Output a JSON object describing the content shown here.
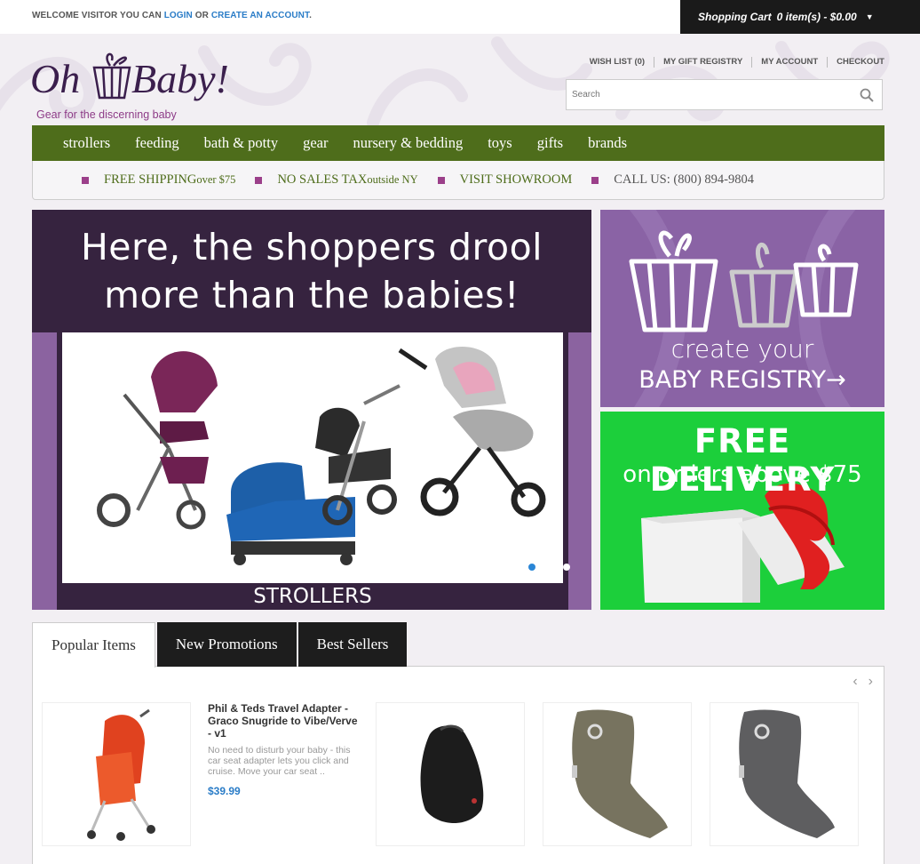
{
  "topbar": {
    "welcome_text": "WELCOME VISITOR YOU CAN ",
    "login_label": "LOGIN",
    "or_text": " OR ",
    "create_account_label": "CREATE AN ACCOUNT",
    "period": ".",
    "cart_label": "Shopping Cart",
    "cart_summary": "0 item(s) - $0.00"
  },
  "logo": {
    "name_left": "Oh",
    "name_right": "Baby!",
    "tagline": "Gear for the discerning baby"
  },
  "top_links": [
    "WISH LIST (0)",
    "MY GIFT REGISTRY",
    "MY ACCOUNT",
    "CHECKOUT"
  ],
  "search": {
    "placeholder": "Search"
  },
  "nav": [
    "strollers",
    "feeding",
    "bath & potty",
    "gear",
    "nursery & bedding",
    "toys",
    "gifts",
    "brands"
  ],
  "promo": {
    "shipping_bold": "FREE SHIPPING",
    "shipping_rest": " over $75",
    "tax_bold": "NO SALES TAX",
    "tax_rest": " outside NY",
    "showroom": "VISIT SHOWROOM",
    "call": "CALL US: (800) 894-9804"
  },
  "hero": {
    "line1": "Here, the shoppers drool",
    "line2": "more than the babies!",
    "caption": "STROLLERS"
  },
  "registry_banner": {
    "line1": "create your",
    "line2": "BABY REGISTRY→"
  },
  "delivery_banner": {
    "line1": "FREE DELIVERY",
    "line2": "on orders above $75"
  },
  "tabs": [
    "Popular Items",
    "New Promotions",
    "Best Sellers"
  ],
  "product": {
    "title": "Phil & Teds Travel Adapter - Graco Snugride to Vibe/Verve - v1",
    "description": "No need to disturb your baby - this car seat adapter lets you click and cruise. Move your car seat ..",
    "price": "$39.99"
  },
  "colors": {
    "nav_green": "#4e6d1b",
    "plum": "#36233f",
    "registry_purple": "#8a63a5",
    "delivery_green": "#1ccf3b",
    "link_blue": "#2a7cc7"
  }
}
